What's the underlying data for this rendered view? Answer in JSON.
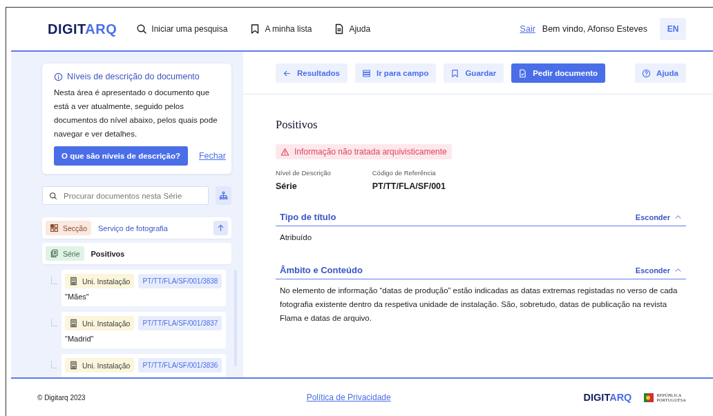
{
  "header": {
    "logo_dark": "DIGIT",
    "logo_accent": "ARQ",
    "nav": [
      {
        "label": "Iniciar uma pesquisa"
      },
      {
        "label": "A minha lista"
      },
      {
        "label": "Ajuda"
      }
    ],
    "logout": "Sair",
    "welcome": "Bem vindo, Afonso Esteves",
    "language": "EN"
  },
  "info_card": {
    "title": "Níveis de descrição do documento",
    "text": "Nesta área é apresentado o documento que está a ver atualmente, seguido pelos documentos do nível abaixo, pelos quais pode navegar e ver detalhes.",
    "button": "O que são níveis de descrição?",
    "close": "Fechar"
  },
  "search": {
    "placeholder": "Procurar documentos nesta Série"
  },
  "tree": [
    {
      "kind": "section",
      "level_label": "Secção",
      "title": "Serviço de fotografia"
    },
    {
      "kind": "series",
      "level_label": "Série",
      "title": "Positivos",
      "children": [
        {
          "kind": "unit",
          "level_label": "Uni. Instalação",
          "code": "PT/TT/FLA/SF/001/3838",
          "title": "\"Mães\""
        },
        {
          "kind": "unit",
          "level_label": "Uni. Instalação",
          "code": "PT/TT/FLA/SF/001/3837",
          "title": "\"Madrid\""
        },
        {
          "kind": "unit",
          "level_label": "Uni. Instalação",
          "code": "PT/TT/FLA/SF/001/3836"
        }
      ]
    }
  ],
  "toolbar": [
    {
      "label": "Resultados",
      "kind": "secondary"
    },
    {
      "label": "Ir para campo",
      "kind": "secondary"
    },
    {
      "label": "Guardar",
      "kind": "secondary"
    },
    {
      "label": "Pedir documento",
      "kind": "primary"
    }
  ],
  "help_button": "Ajuda",
  "document": {
    "title": "Positivos",
    "warning": "Informação não tratada arquivisticamente",
    "fields": [
      {
        "label": "Nível de Descrição",
        "value": "Série"
      },
      {
        "label": "Código de Referência",
        "value": "PT/TT/FLA/SF/001"
      }
    ],
    "sections": [
      {
        "title": "Tipo de título",
        "toggle": "Esconder",
        "expanded": true,
        "body": "Atribuído"
      },
      {
        "title": "Âmbito e Conteúdo",
        "toggle": "Esconder",
        "expanded": true,
        "body": "No elemento de informação “datas de produção” estão indicadas as datas extremas registadas no verso de cada fotografia existente dentro da respetiva unidade de instalação. São, sobretudo, datas de publicação na revista Flama e datas de arquivo."
      }
    ]
  },
  "footer": {
    "copyright": "© Digitarq 2023",
    "privacy": "Política de Privacidade",
    "logo_dark": "DIGIT",
    "logo_accent": "ARQ",
    "republic_line1": "REPÚBLICA",
    "republic_line2": "PORTUGUESA"
  }
}
